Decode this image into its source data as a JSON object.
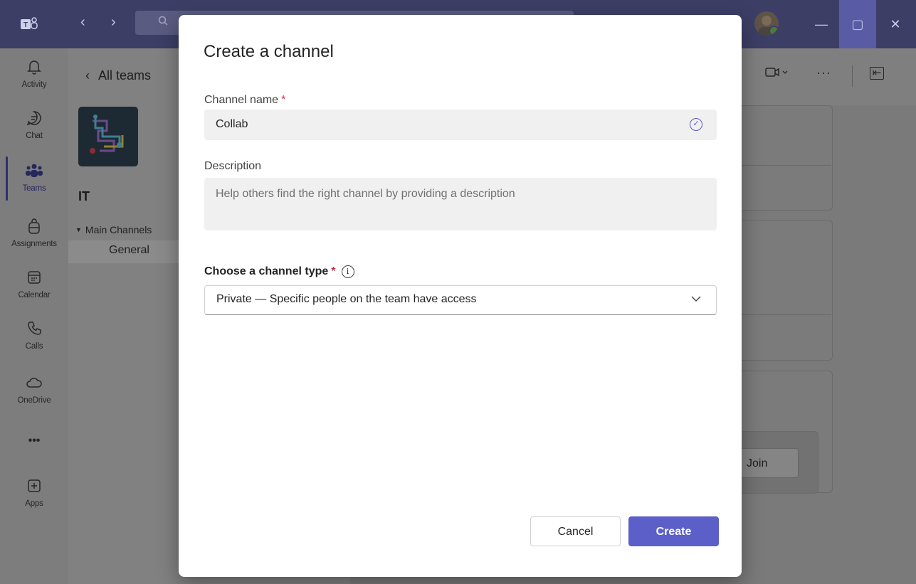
{
  "titlebar": {
    "nav_back": "‹",
    "nav_forward": "›",
    "window_controls": {
      "minimize": "—",
      "maximize": "▢",
      "close": "✕"
    }
  },
  "rail": {
    "items": [
      {
        "label": "Activity",
        "icon": "bell-icon"
      },
      {
        "label": "Chat",
        "icon": "chat-icon"
      },
      {
        "label": "Teams",
        "icon": "teams-icon"
      },
      {
        "label": "Assignments",
        "icon": "backpack-icon"
      },
      {
        "label": "Calendar",
        "icon": "calendar-icon"
      },
      {
        "label": "Calls",
        "icon": "phone-icon"
      },
      {
        "label": "OneDrive",
        "icon": "cloud-icon"
      },
      {
        "label": "",
        "icon": "more-icon"
      },
      {
        "label": "Apps",
        "icon": "add-apps-icon"
      }
    ],
    "more_glyph": "•••"
  },
  "team_pane": {
    "back_label": "All teams",
    "team_name": "IT",
    "section_label": "Main Channels",
    "channels": [
      "General"
    ]
  },
  "main": {
    "join_label": "Join",
    "more_glyph": "···"
  },
  "modal": {
    "title": "Create a channel",
    "channel_name": {
      "label": "Channel name",
      "required_mark": "*",
      "value": "Collab"
    },
    "description": {
      "label": "Description",
      "placeholder": "Help others find the right channel by providing a description"
    },
    "channel_type": {
      "label": "Choose a channel type",
      "required_mark": "*",
      "selected": "Private — Specific people on the team have access"
    },
    "buttons": {
      "cancel": "Cancel",
      "create": "Create"
    }
  },
  "colors": {
    "accent": "#5b5fc7",
    "required": "#c4314b"
  }
}
